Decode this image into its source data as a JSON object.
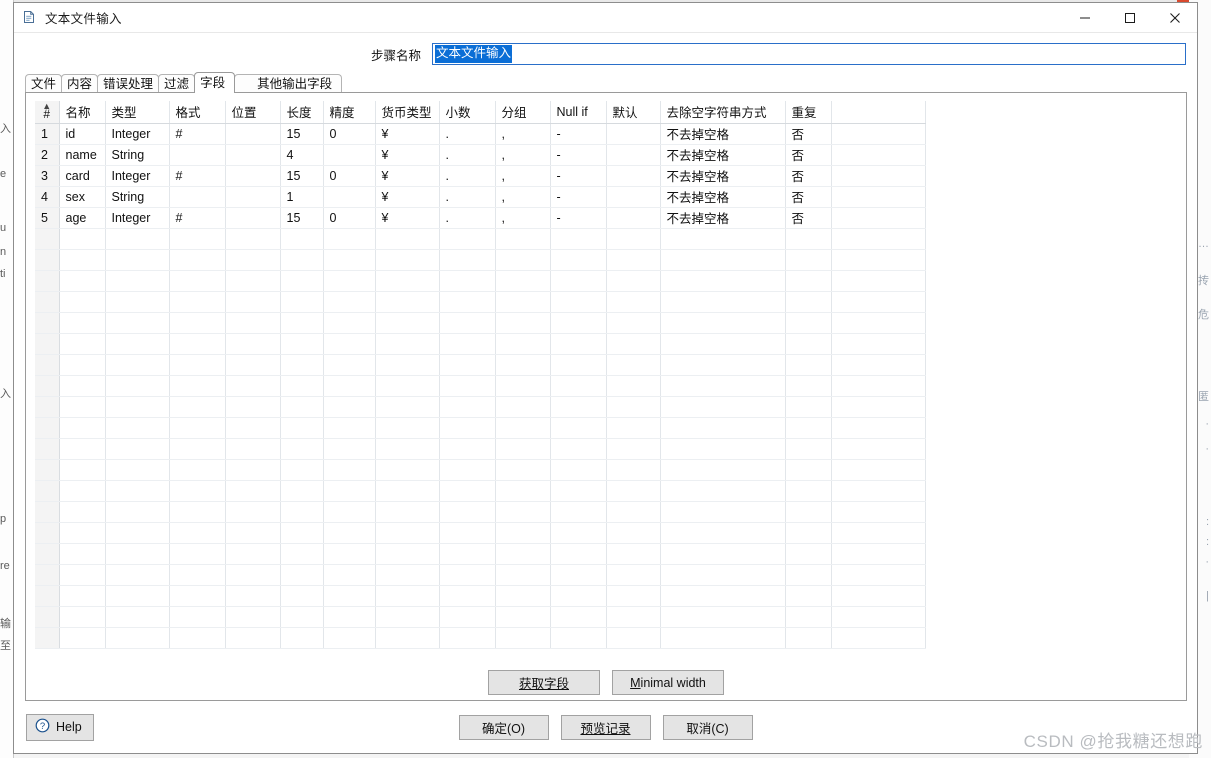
{
  "window": {
    "title": "文本文件输入",
    "icon": "document-icon",
    "controls": {
      "minimize": "minimize-icon",
      "maximize": "maximize-icon",
      "close": "close-icon"
    }
  },
  "step": {
    "label": "步骤名称",
    "value": "文本文件输入",
    "placeholder": "",
    "selection_color": "#0b6ed6"
  },
  "tabs": [
    {
      "label": "文件",
      "active": false
    },
    {
      "label": "内容",
      "active": false
    },
    {
      "label": "错误处理",
      "active": false
    },
    {
      "label": "过滤",
      "active": false
    },
    {
      "label": "字段",
      "active": true
    },
    {
      "label": "其他输出字段",
      "active": false
    }
  ],
  "grid": {
    "sort_caret": "▲",
    "columns": [
      "#",
      "名称",
      "类型",
      "格式",
      "位置",
      "长度",
      "精度",
      "货币类型",
      "小数",
      "分组",
      "Null if",
      "默认",
      "去除空字符串方式",
      "重复"
    ],
    "rows": [
      {
        "num": "1",
        "名称": "id",
        "类型": "Integer",
        "格式": "#",
        "位置": "",
        "长度": "15",
        "精度": "0",
        "货币类型": "¥",
        "小数": ".",
        "分组": ",",
        "Null if": "-",
        "默认": "",
        "去除空字符串方式": "不去掉空格",
        "重复": "否"
      },
      {
        "num": "2",
        "名称": "name",
        "类型": "String",
        "格式": "",
        "位置": "",
        "长度": "4",
        "精度": "",
        "货币类型": "¥",
        "小数": ".",
        "分组": ",",
        "Null if": "-",
        "默认": "",
        "去除空字符串方式": "不去掉空格",
        "重复": "否"
      },
      {
        "num": "3",
        "名称": "card",
        "类型": "Integer",
        "格式": "#",
        "位置": "",
        "长度": "15",
        "精度": "0",
        "货币类型": "¥",
        "小数": ".",
        "分组": ",",
        "Null if": "-",
        "默认": "",
        "去除空字符串方式": "不去掉空格",
        "重复": "否"
      },
      {
        "num": "4",
        "名称": "sex",
        "类型": "String",
        "格式": "",
        "位置": "",
        "长度": "1",
        "精度": "",
        "货币类型": "¥",
        "小数": ".",
        "分组": ",",
        "Null if": "-",
        "默认": "",
        "去除空字符串方式": "不去掉空格",
        "重复": "否"
      },
      {
        "num": "5",
        "名称": "age",
        "类型": "Integer",
        "格式": "#",
        "位置": "",
        "长度": "15",
        "精度": "0",
        "货币类型": "¥",
        "小数": ".",
        "分组": ",",
        "Null if": "-",
        "默认": "",
        "去除空字符串方式": "不去掉空格",
        "重复": "否"
      }
    ],
    "empty_row_count": 20
  },
  "grid_buttons": {
    "get_fields": "获取字段",
    "minimal_width_prefix": "M",
    "minimal_width_rest": "inimal width"
  },
  "footer": {
    "help": "Help",
    "help_icon": "question-circle-icon",
    "ok": "确定(O)",
    "preview": "预览记录",
    "cancel": "取消(C)"
  },
  "watermark": "CSDN @抢我糖还想跑",
  "background_fragments_left": [
    "入",
    "e",
    "u",
    "n",
    "ti",
    "入",
    "p",
    "re",
    "输",
    "至"
  ],
  "background_fragments_right": [
    "L…",
    "抟",
    "危",
    "匿",
    "·",
    "·",
    ":",
    ":",
    "·",
    "|"
  ]
}
